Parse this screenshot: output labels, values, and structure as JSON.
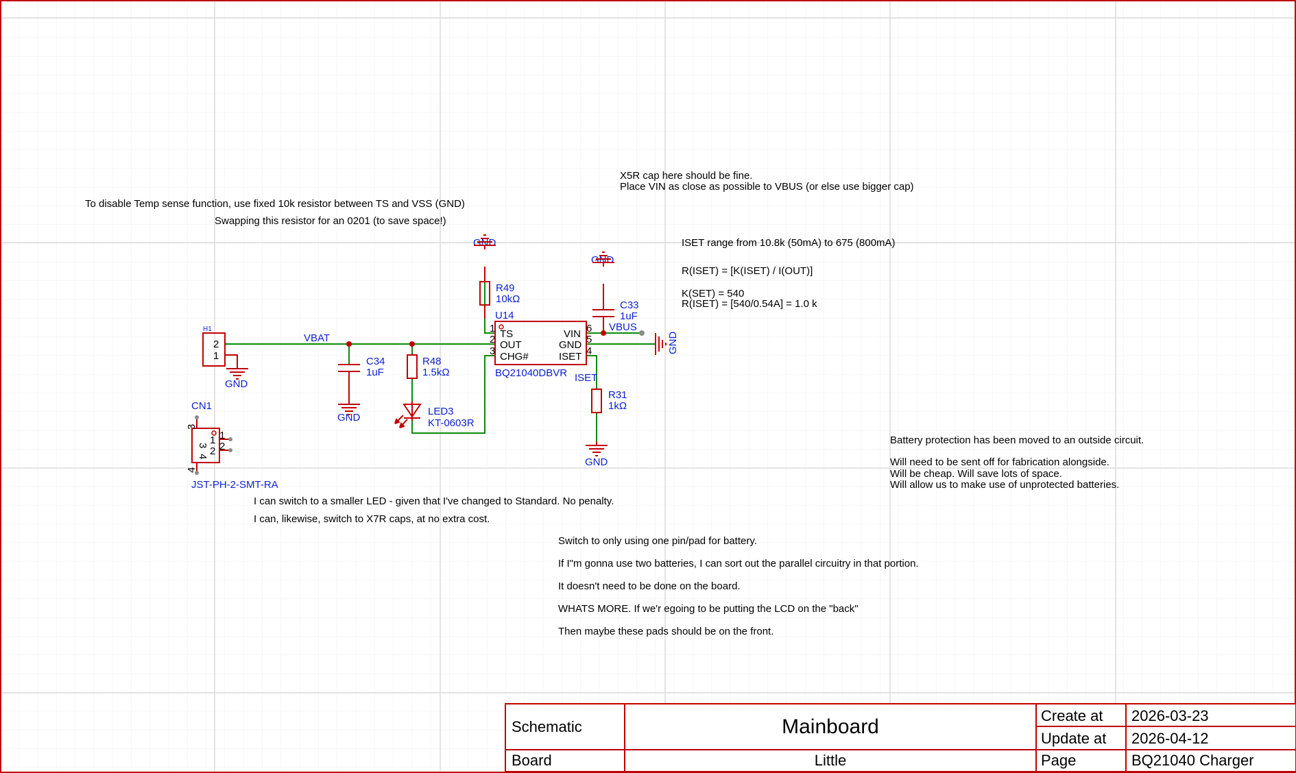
{
  "notes": {
    "temp_sense": "To disable Temp sense function, use fixed 10k resistor between TS and VSS (GND)",
    "swap_resistor": "Swapping this resistor for an 0201 (to save space!)",
    "x5r_cap": "X5R cap here should be fine.",
    "place_vin": "Place VIN as close as possible to VBUS (or else use bigger cap)",
    "iset_range": "ISET range from 10.8k (50mA) to 675 (800mA)",
    "r_iset_formula": "R(ISET) = [K(ISET) / I(OUT)]",
    "k_set": "K(SET) = 540",
    "r_iset_value": "R(ISET) = [540/0.54A] = 1.0 k",
    "battery_protection": "Battery protection has been moved to an outside circuit.",
    "fabrication": "Will need to be sent off for fabrication alongside.",
    "cheap": "Will be cheap. Will save lots of space.",
    "unprotected": "Will allow us to make use of unprotected batteries.",
    "smaller_led": "I can switch to a smaller LED - given that I've changed to Standard. No penalty.",
    "x7r_caps": "I can, likewise, switch to X7R caps, at no extra cost.",
    "one_pin": "Switch to only using one pin/pad for battery.",
    "two_batteries": "If I\"m gonna use two batteries, I can sort out the parallel circuitry in that portion.",
    "not_on_board": "It doesn't need to be done on the board.",
    "whats_more": "WHATS MORE. If we'r egoing to be putting the LCD on the \"back\"",
    "pads_front": "Then maybe these pads should be on the front."
  },
  "components": {
    "h1": {
      "ref": "H1",
      "pin2": "2",
      "pin1": "1"
    },
    "cn1": {
      "ref": "CN1",
      "value": "JST-PH-2-SMT-RA",
      "pin1": "1",
      "pin2": "2",
      "pin3": "3",
      "pin4": "4"
    },
    "c34": {
      "ref": "C34",
      "value": "1uF"
    },
    "r48": {
      "ref": "R48",
      "value": "1.5kΩ"
    },
    "led3": {
      "ref": "LED3",
      "value": "KT-0603R"
    },
    "r49": {
      "ref": "R49",
      "value": "10kΩ"
    },
    "u14": {
      "ref": "U14",
      "value": "BQ21040DBVR",
      "pins_left": [
        {
          "num": "1",
          "name": "TS"
        },
        {
          "num": "2",
          "name": "OUT"
        },
        {
          "num": "3",
          "name": "CHG#"
        }
      ],
      "pins_right": [
        {
          "num": "6",
          "name": "VIN"
        },
        {
          "num": "5",
          "name": "GND"
        },
        {
          "num": "4",
          "name": "ISET"
        }
      ]
    },
    "c33": {
      "ref": "C33",
      "value": "1uF"
    },
    "r31": {
      "ref": "R31",
      "value": "1kΩ"
    }
  },
  "nets": {
    "vbat": "VBAT",
    "vbus": "VBUS",
    "iset": "ISET",
    "gnd": "GND"
  },
  "title_block": {
    "schematic_label": "Schematic",
    "schematic_value": "Mainboard",
    "board_label": "Board",
    "board_value": "Little",
    "create_label": "Create at",
    "create_value": "2026-03-23",
    "update_label": "Update at",
    "update_value": "2026-04-12",
    "page_label": "Page",
    "page_value": "BQ21040 Charger"
  },
  "colors": {
    "border": "#c00000",
    "wire": "#0a8a0a",
    "part": "#c00000",
    "label": "#0b1fd0",
    "grid_major": "#dcdcdc",
    "grid_minor": "#efefef"
  }
}
